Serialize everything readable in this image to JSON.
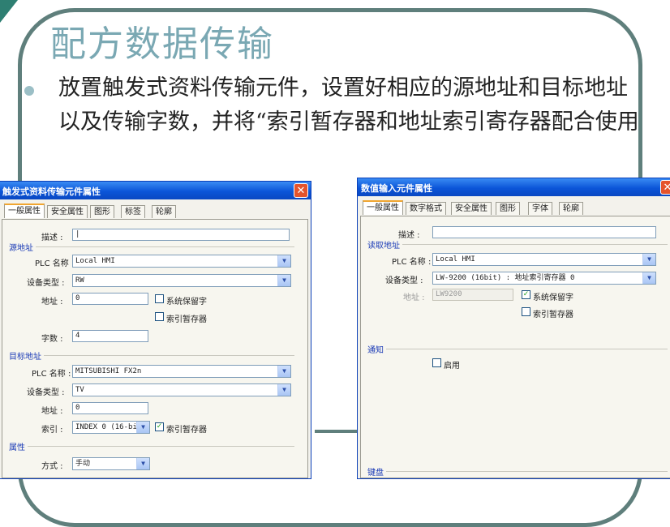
{
  "slide": {
    "title": "配方数据传输",
    "bullet": "放置触发式资料传输元件，设置好相应的源地址和目标地址以及传输字数，并将“索引暂存器和地址索引寄存器配合使用"
  },
  "left_dialog": {
    "title": "触发式资料传输元件属性",
    "close": "✕",
    "tabs": [
      "一般属性",
      "安全属性",
      "图形",
      "标签",
      "轮廓"
    ],
    "desc_label": "描述 :",
    "source": {
      "group": "源地址",
      "plc_label": "PLC 名称 :",
      "plc_value": "Local HMI",
      "device_label": "设备类型 :",
      "device_value": "RW",
      "addr_label": "地址 :",
      "addr_value": "0",
      "sys_reserved": "系统保留字",
      "index_reg": "索引暂存器",
      "words_label": "字数 :",
      "words_value": "4"
    },
    "target": {
      "group": "目标地址",
      "plc_label": "PLC 名称 :",
      "plc_value": "MITSUBISHI FX2n",
      "device_label": "设备类型 :",
      "device_value": "TV",
      "addr_label": "地址 :",
      "addr_value": "0",
      "index_label": "索引 :",
      "index_value": "INDEX 0 (16-bi",
      "index_reg": "索引暂存器"
    },
    "attr": {
      "group": "属性",
      "mode_label": "方式 :",
      "mode_value": "手动"
    }
  },
  "right_dialog": {
    "title": "数值输入元件属性",
    "close": "✕",
    "tabs": [
      "一般属性",
      "数字格式",
      "安全属性",
      "图形",
      "字体",
      "轮廓"
    ],
    "desc_label": "描述 :",
    "read": {
      "group": "读取地址",
      "plc_label": "PLC 名称 :",
      "plc_value": "Local HMI",
      "device_label": "设备类型 :",
      "device_value": "LW-9200 (16bit) : 地址索引寄存器 0",
      "addr_label": "地址 :",
      "addr_value": "LW9200",
      "sys_reserved": "系统保留字",
      "index_reg": "索引暂存器"
    },
    "notify": {
      "group": "通知",
      "enable": "启用"
    },
    "keyboard": {
      "group": "键盘"
    }
  },
  "icons": {
    "check": "✓",
    "dropdown": "▼"
  }
}
